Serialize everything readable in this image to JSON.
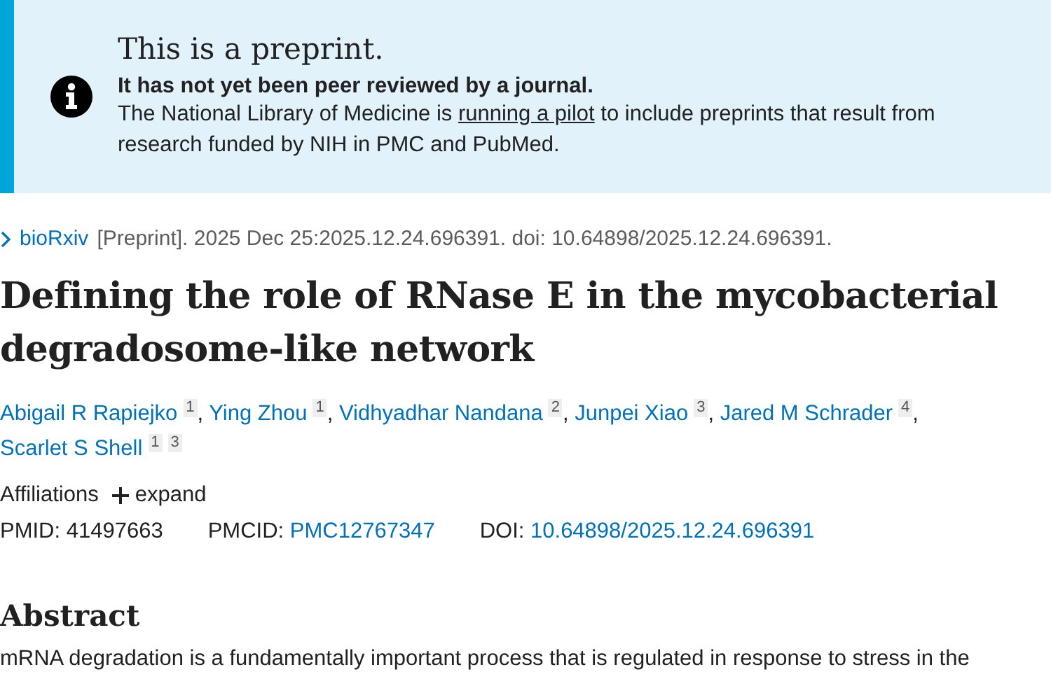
{
  "notice": {
    "title": "This is a preprint.",
    "subtitle": "It has not yet been peer reviewed by a journal.",
    "text_before": "The National Library of Medicine is",
    "link": "running a pilot",
    "text_after": "to include preprints that result from research funded by NIH in PMC and PubMed."
  },
  "citation": {
    "journal": "bioRxiv",
    "text": "[Preprint]. 2025 Dec 25:2025.12.24.696391. doi: 10.64898/2025.12.24.696391."
  },
  "title": "Defining the role of RNase E in the mycobacterial degradosome-like network",
  "authors": [
    {
      "name": "Abigail R Rapiejko",
      "affiliations": [
        "1"
      ],
      "separator": ","
    },
    {
      "name": "Ying Zhou",
      "affiliations": [
        "1"
      ],
      "separator": ","
    },
    {
      "name": "Vidhyadhar Nandana",
      "affiliations": [
        "2"
      ],
      "separator": ","
    },
    {
      "name": "Junpei Xiao",
      "affiliations": [
        "3"
      ],
      "separator": ","
    },
    {
      "name": "Jared M Schrader",
      "affiliations": [
        "4"
      ],
      "separator": ","
    },
    {
      "name": "Scarlet S Shell",
      "affiliations": [
        "1",
        "3"
      ]
    }
  ],
  "affiliations": {
    "label": "Affiliations",
    "toggle": "expand",
    "expanded": false
  },
  "ids": [
    {
      "label": "PMID:",
      "value": "41497663",
      "kind": "text"
    },
    {
      "label": "PMCID:",
      "value": "PMC12767347",
      "kind": "link"
    },
    {
      "label": "DOI:",
      "value": "10.64898/2025.12.24.696391",
      "kind": "link"
    }
  ],
  "abstract": {
    "heading": "Abstract",
    "text": "mRNA degradation is a fundamentally important process that is regulated in response to stress in the"
  }
}
